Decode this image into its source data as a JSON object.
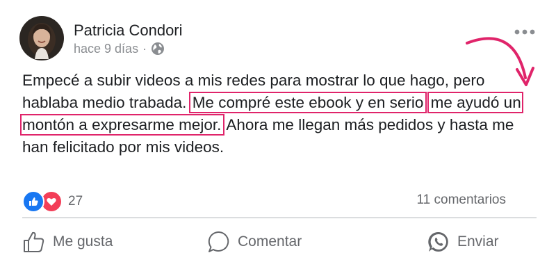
{
  "post": {
    "author": "Patricia Condori",
    "time": "hace 9 días",
    "separator": "·",
    "privacy_icon": "globe-icon",
    "more_icon": "more-horizontal-icon",
    "text_part1": "Empecé a subir videos a mis redes para mostrar lo que hago, pero hablaba medio trabada. ",
    "text_highlight1": "Me compré este ebook y en serio",
    "text_highlight2": "me ayudó un montón a expresarme mejor.",
    "text_part2": " Ahora me llegan más pedidos y hasta me han felicitado por mis videos.",
    "highlight_color": "#e0246a"
  },
  "reactions": {
    "icons": [
      "like-reaction-icon",
      "love-reaction-icon"
    ],
    "count": "27",
    "comments": "11 comentarios"
  },
  "actions": {
    "like_label": "Me gusta",
    "comment_label": "Comentar",
    "share_label": "Enviar"
  },
  "colors": {
    "like_blue": "#1877f2",
    "love_red": "#f33e58",
    "muted": "#65676b",
    "arrow": "#e0246a"
  }
}
